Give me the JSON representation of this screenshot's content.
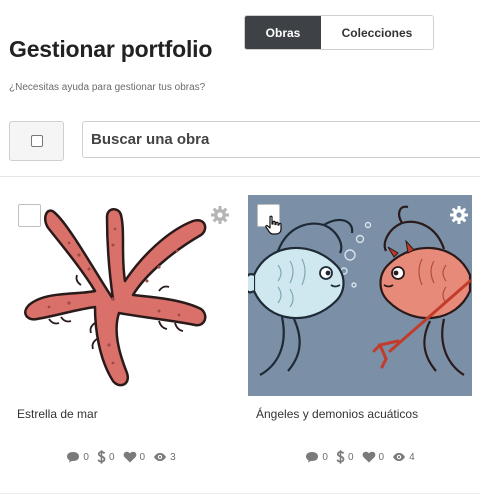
{
  "header": {
    "title": "Gestionar portfolio",
    "help_text": "¿Necesitas ayuda para gestionar tus obras?"
  },
  "tabs": [
    {
      "label": "Obras",
      "active": true
    },
    {
      "label": "Colecciones",
      "active": false
    }
  ],
  "search": {
    "placeholder": "Buscar una obra"
  },
  "colors": {
    "active_tab_bg": "#3e4247",
    "starfish": "#d9716a",
    "fish_scene_bg": "#7b8fa6",
    "fish_blue": "#cfe8ef",
    "fish_red": "#e88a7a"
  },
  "artworks": [
    {
      "title": "Estrella de mar",
      "image": "starfish-illustration",
      "comments": "0",
      "price": "0",
      "likes": "0",
      "views": "3"
    },
    {
      "title": "Ángeles y demonios acuáticos",
      "image": "angel-devil-fish-illustration",
      "comments": "0",
      "price": "0",
      "likes": "0",
      "views": "4"
    }
  ]
}
